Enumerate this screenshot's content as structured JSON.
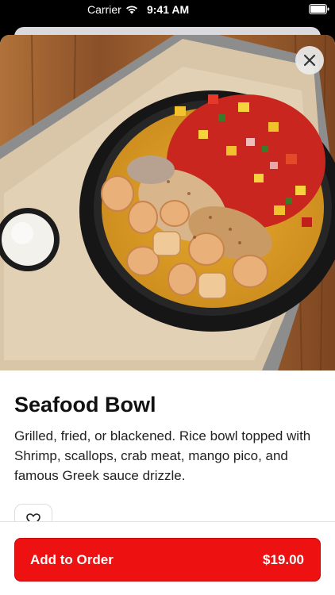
{
  "status_bar": {
    "carrier": "Carrier",
    "time": "9:41 AM"
  },
  "item": {
    "title": "Seafood Bowl",
    "description": "Grilled, fried, or blackened. Rice bowl topped with Shrimp, scallops, crab meat, mango pico, and famous Greek sauce drizzle.",
    "image_subject": "seafood-bowl-photo"
  },
  "order_button": {
    "label": "Add to Order",
    "price": "$19.00"
  },
  "icons": {
    "close": "close-icon",
    "favorite": "heart-icon",
    "wifi": "wifi-icon",
    "battery": "battery-icon"
  },
  "colors": {
    "accent": "#ee1111",
    "background": "#ffffff",
    "text": "#111111"
  }
}
